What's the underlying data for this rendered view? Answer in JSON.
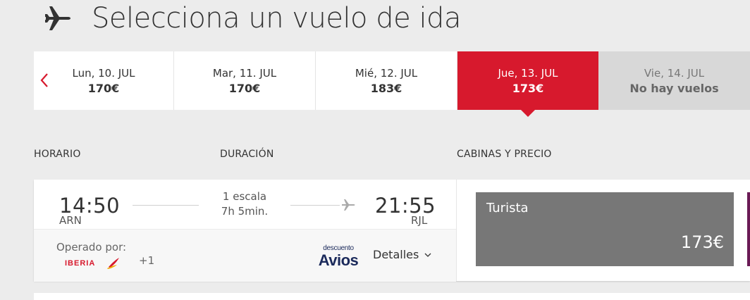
{
  "header": {
    "title": "Selecciona un vuelo de ida",
    "icon": "airplane-icon"
  },
  "date_strip": {
    "prev_icon": "chevron-left-icon",
    "days": [
      {
        "label": "Lun, 10. JUL",
        "price": "170€"
      },
      {
        "label": "Mar, 11. JUL",
        "price": "170€"
      },
      {
        "label": "Mié, 12. JUL",
        "price": "183€"
      },
      {
        "label": "Jue, 13. JUL",
        "price": "173€",
        "selected": true
      },
      {
        "label": "Vie, 14. JUL",
        "price": "No hay vuelos",
        "disabled": true
      }
    ]
  },
  "columns": {
    "schedule": "HORARIO",
    "duration": "DURACIÓN",
    "cabins": "CABINAS Y PRECIO"
  },
  "flight": {
    "depart_time": "14:50",
    "depart_airport": "ARN",
    "stops": "1 escala",
    "duration": "7h 5min.",
    "arrive_time": "21:55",
    "arrive_airport": "RJL",
    "operated_by": "Operado por:",
    "airline_logo": "IBERIA",
    "more_airlines": "+1",
    "avios_top": "descuento",
    "avios_main": "Avios",
    "details": "Detalles",
    "fare": {
      "name": "Turista",
      "price": "173€"
    }
  },
  "colors": {
    "accent": "#d7192d",
    "fare_bg": "#777777",
    "premium_edge": "#6a1a55"
  }
}
